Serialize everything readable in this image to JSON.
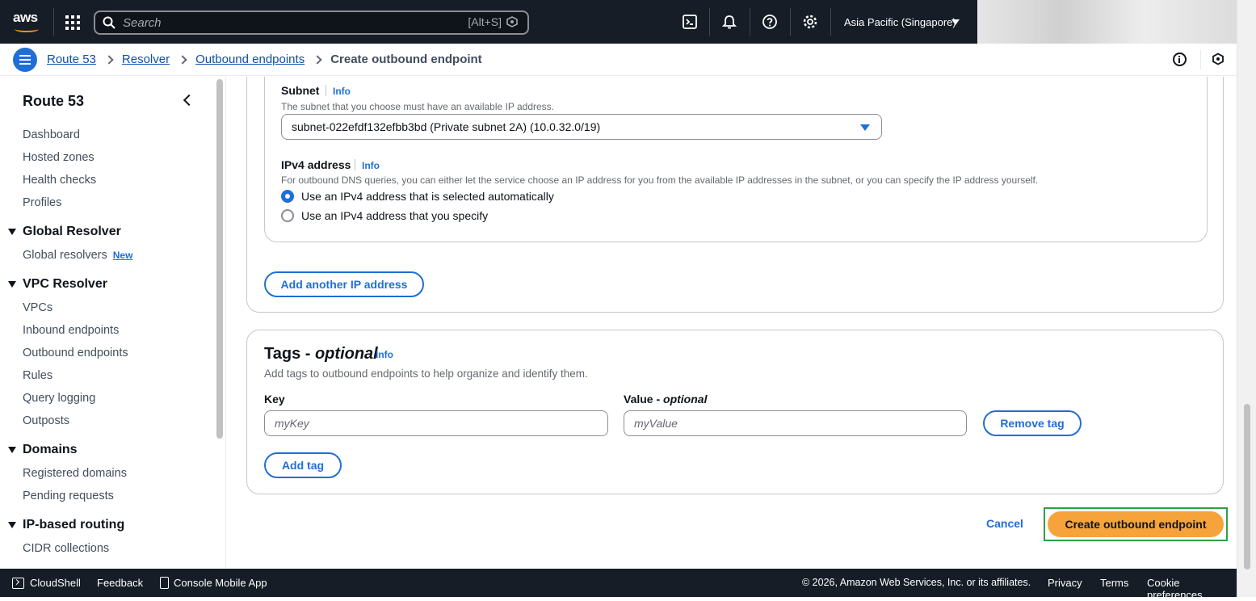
{
  "topnav": {
    "logo_text": "aws",
    "search_placeholder": "Search",
    "search_shortcut": "[Alt+S]",
    "region": "Asia Pacific (Singapore)"
  },
  "breadcrumb": {
    "items": [
      "Route 53",
      "Resolver",
      "Outbound endpoints"
    ],
    "current": "Create outbound endpoint"
  },
  "sidebar": {
    "title": "Route 53",
    "top_items": [
      "Dashboard",
      "Hosted zones",
      "Health checks",
      "Profiles"
    ],
    "sections": [
      {
        "title": "Global Resolver",
        "items": [
          "Global resolvers"
        ],
        "badge": "New"
      },
      {
        "title": "VPC Resolver",
        "items": [
          "VPCs",
          "Inbound endpoints",
          "Outbound endpoints",
          "Rules",
          "Query logging",
          "Outposts"
        ]
      },
      {
        "title": "Domains",
        "items": [
          "Registered domains",
          "Pending requests"
        ]
      },
      {
        "title": "IP-based routing",
        "items": [
          "CIDR collections"
        ]
      }
    ]
  },
  "ip_config": {
    "subnet_label": "Subnet",
    "info": "Info",
    "subnet_desc": "The subnet that you choose must have an available IP address.",
    "subnet_value": "subnet-022efdf132efbb3bd (Private subnet 2A) (10.0.32.0/19)",
    "ipv4_label": "IPv4 address",
    "ipv4_desc": "For outbound DNS queries, you can either let the service choose an IP address for you from the available IP addresses in the subnet, or you can specify the IP address yourself.",
    "radio_auto": "Use an IPv4 address that is selected automatically",
    "radio_specify": "Use an IPv4 address that you specify",
    "add_ip_button": "Add another IP address"
  },
  "tags": {
    "title": "Tags - ",
    "title_optional": "optional",
    "info": "Info",
    "desc": "Add tags to outbound endpoints to help organize and identify them.",
    "key_label": "Key",
    "value_label": "Value - ",
    "value_optional": "optional",
    "key_placeholder": "myKey",
    "value_placeholder": "myValue",
    "remove_button": "Remove tag",
    "add_button": "Add tag"
  },
  "actions": {
    "cancel": "Cancel",
    "create": "Create outbound endpoint"
  },
  "footer": {
    "cloudshell": "CloudShell",
    "feedback": "Feedback",
    "mobile_app": "Console Mobile App",
    "copyright": "© 2026, Amazon Web Services, Inc. or its affiliates.",
    "privacy": "Privacy",
    "terms": "Terms",
    "cookies": "Cookie preferences"
  },
  "colors": {
    "accent": "#1f6fd6",
    "primary_button": "#f6a33b",
    "nav_bg": "#161d26",
    "highlight_frame": "#2ea043"
  }
}
